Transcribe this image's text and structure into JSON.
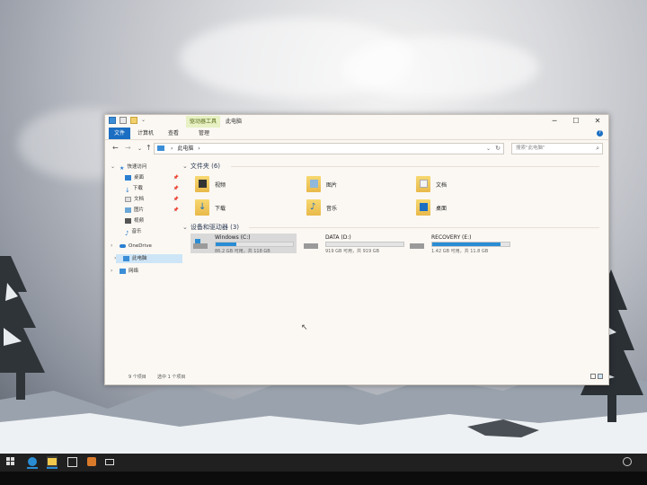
{
  "window": {
    "title": "此电脑",
    "context_tab": "驱动器工具",
    "minimize": "─",
    "maximize": "☐",
    "close": "✕"
  },
  "ribbon": {
    "tabs": [
      "文件",
      "计算机",
      "查看",
      "管理"
    ],
    "help": "?"
  },
  "address": {
    "back": "←",
    "forward": "→",
    "recent": "⌄",
    "up": "↑",
    "crumb": "此电脑",
    "crumb_sep": "›",
    "dropdown": "⌄",
    "refresh": "↻"
  },
  "search": {
    "placeholder": "搜索\"此电脑\"",
    "icon": "search-icon"
  },
  "nav": {
    "quick_access": "快速访问",
    "items": [
      {
        "label": "桌面",
        "icon": "desktop-icon",
        "color": "#2a7fd1"
      },
      {
        "label": "下载",
        "icon": "download-icon",
        "color": "#2a7fd1"
      },
      {
        "label": "文档",
        "icon": "documents-icon",
        "color": "#8a8a8a"
      },
      {
        "label": "图片",
        "icon": "pictures-icon",
        "color": "#6aa7d6"
      },
      {
        "label": "视频",
        "icon": "videos-icon",
        "color": "#555555"
      },
      {
        "label": "音乐",
        "icon": "music-icon",
        "color": "#2a7fd1"
      }
    ],
    "onedrive": "OneDrive",
    "this_pc": "此电脑",
    "network": "网络"
  },
  "folders_section": {
    "title": "文件夹 (6)",
    "folders": [
      {
        "label": "视频",
        "icon": "videos-folder-icon"
      },
      {
        "label": "图片",
        "icon": "pictures-folder-icon"
      },
      {
        "label": "文档",
        "icon": "documents-folder-icon"
      },
      {
        "label": "下载",
        "icon": "downloads-folder-icon"
      },
      {
        "label": "音乐",
        "icon": "music-folder-icon"
      },
      {
        "label": "桌面",
        "icon": "desktop-folder-icon"
      }
    ]
  },
  "drives_section": {
    "title": "设备和驱动器 (3)",
    "drives": [
      {
        "name": "Windows (C:)",
        "info": "86.2 GB 可用，共 118 GB",
        "used_fraction": 0.27,
        "selected": true
      },
      {
        "name": "DATA (D:)",
        "info": "919 GB 可用，共 919 GB",
        "used_fraction": 0.0,
        "selected": false
      },
      {
        "name": "RECOVERY (E:)",
        "info": "1.42 GB 可用，共 11.8 GB",
        "used_fraction": 0.88,
        "selected": false
      }
    ]
  },
  "status": {
    "count": "9 个项目",
    "selected": "选中 1 个项目"
  },
  "colors": {
    "accent": "#1b6ec2",
    "drive_fill": "#2a8dd4",
    "context_tab_bg": "#e7f1c4"
  }
}
